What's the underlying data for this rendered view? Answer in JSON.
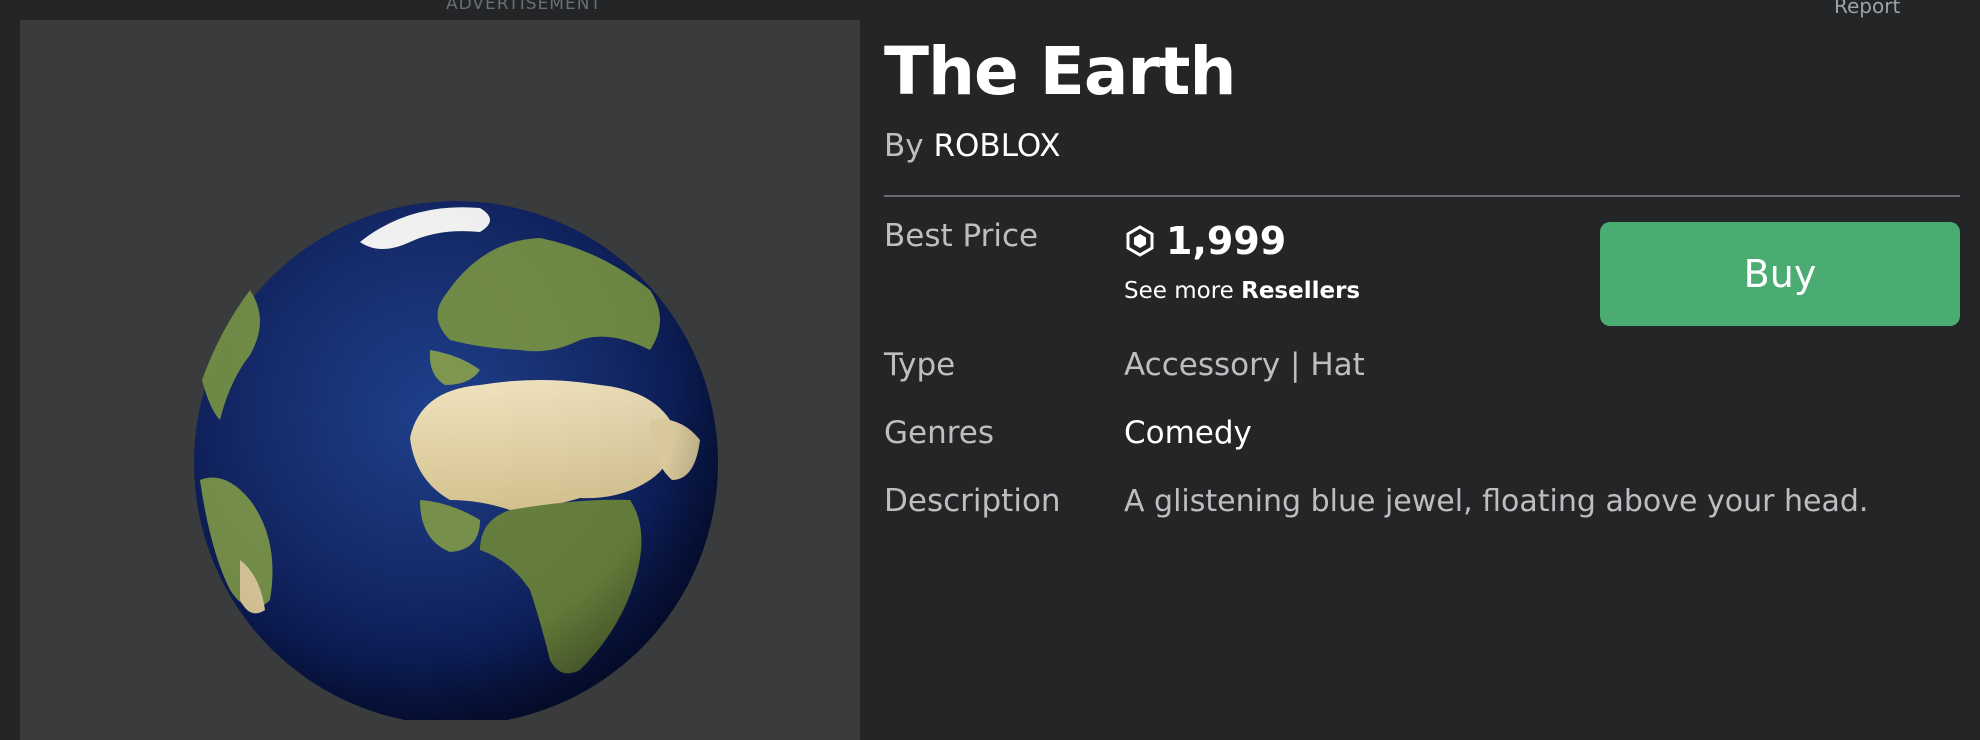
{
  "header": {
    "ad_label": "ADVERTISEMENT",
    "report_label": "Report"
  },
  "item": {
    "title": "The Earth",
    "by_prefix": "By",
    "creator": "ROBLOX",
    "thumbnail_icon": "earth-globe-thumbnail"
  },
  "details": {
    "best_price_label": "Best Price",
    "price": "1,999",
    "currency_icon": "robux-icon",
    "see_more_prefix": "See more",
    "resellers_link": "Resellers",
    "buy_label": "Buy",
    "type_label": "Type",
    "type_value": "Accessory | Hat",
    "genres_label": "Genres",
    "genres_value": "Comedy",
    "description_label": "Description",
    "description_value": "A glistening blue jewel, floating above your head."
  },
  "colors": {
    "background": "#232527",
    "panel": "#393b3d",
    "buy_button": "#4aac72",
    "muted_text": "#bdbec0",
    "divider": "#6a6c70"
  }
}
